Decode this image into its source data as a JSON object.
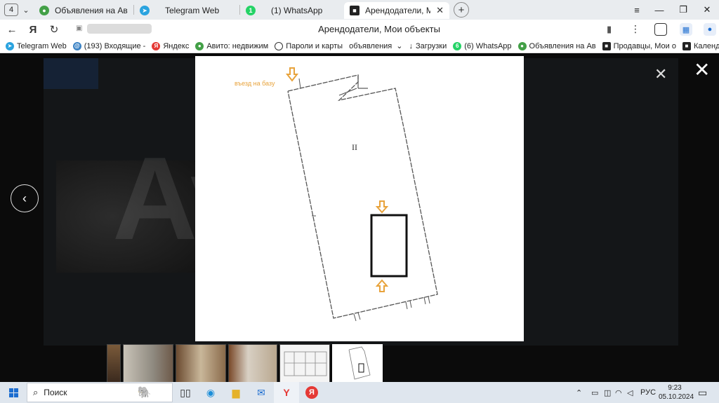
{
  "browser": {
    "tab_count": "4",
    "tabs": [
      {
        "title": "Объявления на Авито Pr",
        "icon": "avito-icon",
        "active": false
      },
      {
        "title": "Telegram Web",
        "icon": "telegram-icon",
        "active": false
      },
      {
        "title": "(1) WhatsApp",
        "icon": "whatsapp-icon",
        "active": false
      },
      {
        "title": "Арендодатели, Мои об",
        "icon": "site-icon",
        "active": true
      }
    ],
    "page_title": "Арендодатели, Мои объекты",
    "bookmarks": [
      {
        "label": "Telegram Web",
        "icon": "telegram-icon",
        "color": "#2aa3df"
      },
      {
        "label": "(193) Входящие -",
        "icon": "mail-icon",
        "color": "#3b82c4"
      },
      {
        "label": "Яндекс",
        "icon": "yandex-icon",
        "color": "#e53935"
      },
      {
        "label": "Авито: недвижим",
        "icon": "avito-icon",
        "color": "#43a047"
      },
      {
        "label": "Пароли и карты",
        "icon": "key-icon",
        "color": "#333333"
      },
      {
        "label": "объявления",
        "icon": "folder-icon",
        "color": "#333333"
      },
      {
        "label": "Загрузки",
        "icon": "download-icon",
        "color": "#333333"
      },
      {
        "label": "(6) WhatsApp",
        "icon": "whatsapp-icon",
        "color": "#25d366"
      },
      {
        "label": "Объявления на Ав",
        "icon": "avito-icon",
        "color": "#43a047"
      },
      {
        "label": "Продавцы, Мои о",
        "icon": "site-icon",
        "color": "#222222"
      },
      {
        "label": "Календарь",
        "icon": "site-icon",
        "color": "#222222"
      }
    ]
  },
  "viewer": {
    "plan_label": "въезд на базу",
    "roman": "II",
    "watermark": "Avito"
  },
  "taskbar": {
    "search_label": "Поиск",
    "lang": "РУС",
    "time": "9:23",
    "date": "05.10.2024"
  },
  "colors": {
    "arrow": "#e8a33c",
    "plan_line": "#555555"
  }
}
